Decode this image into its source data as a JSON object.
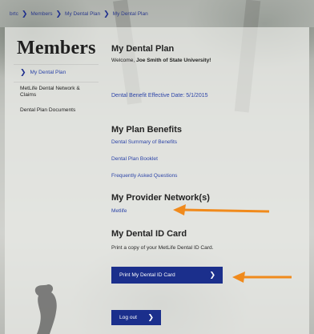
{
  "breadcrumb": [
    "brtc",
    "Members",
    "My Dental Plan",
    "My Dental Plan"
  ],
  "sidebar": {
    "title": "Members",
    "items": [
      {
        "label": "My Dental Plan"
      },
      {
        "label": "MetLife Dental Network & Claims"
      },
      {
        "label": "Dental Plan Documents"
      }
    ]
  },
  "main": {
    "title": "My Dental Plan",
    "welcome_prefix": "Welcome,",
    "welcome_name": "Joe Smith of State University!",
    "effective_date": "Dental Benefit Effective Date:  5/1/2015",
    "plan_benefits": {
      "heading": "My Plan Benefits",
      "links": [
        "Dental Summary of Benefits",
        "Dental Plan Booklet",
        "Frequently Asked Questions"
      ]
    },
    "provider_network": {
      "heading": "My Provider Network(s)",
      "link": "Metlife"
    },
    "id_card": {
      "heading": "My Dental ID Card",
      "description": "Print a copy of your MetLife Dental ID Card.",
      "button": "Print My Dental ID Card"
    },
    "logout_button": "Log out"
  },
  "colors": {
    "brand_blue": "#1b2f8c",
    "link_blue": "#2d45a8",
    "annotation_arrow": "#f08a1c"
  },
  "icons": {
    "breadcrumb_separator": "chevron-right-icon",
    "button_chevron": "chevron-right-icon"
  }
}
